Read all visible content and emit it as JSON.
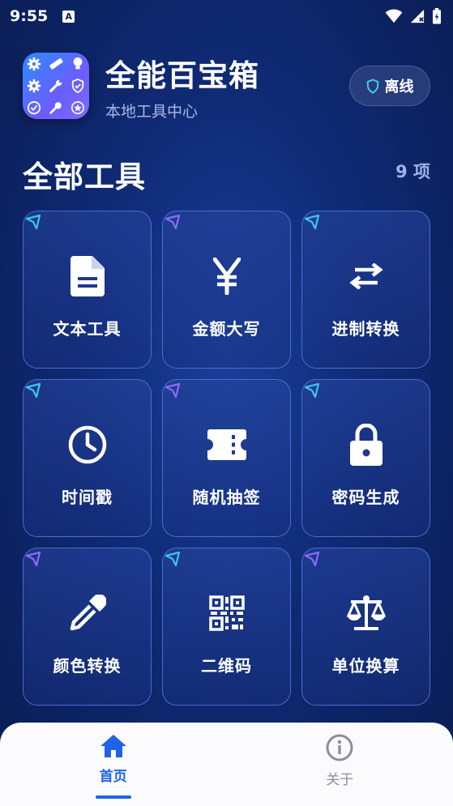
{
  "status_bar": {
    "time": "9:55",
    "notification_badge": "A"
  },
  "header": {
    "app_title": "全能百宝箱",
    "app_subtitle": "本地工具中心",
    "offline_label": "离线"
  },
  "section": {
    "title": "全部工具",
    "count": "9 项"
  },
  "tools": [
    {
      "label": "文本工具",
      "icon": "document-icon",
      "corner_color": "#3ec6e8"
    },
    {
      "label": "金额大写",
      "icon": "yen-icon",
      "corner_color": "#8a6cff"
    },
    {
      "label": "进制转换",
      "icon": "swap-arrows-icon",
      "corner_color": "#3ec6e8"
    },
    {
      "label": "时间戳",
      "icon": "clock-icon",
      "corner_color": "#3ec6e8"
    },
    {
      "label": "随机抽签",
      "icon": "ticket-icon",
      "corner_color": "#8a6cff"
    },
    {
      "label": "密码生成",
      "icon": "lock-icon",
      "corner_color": "#3ec6e8"
    },
    {
      "label": "颜色转换",
      "icon": "eyedropper-icon",
      "corner_color": "#8a6cff"
    },
    {
      "label": "二维码",
      "icon": "qr-code-icon",
      "corner_color": "#3ec6e8"
    },
    {
      "label": "单位换算",
      "icon": "scale-icon",
      "corner_color": "#8a6cff"
    }
  ],
  "bottom_nav": {
    "home_label": "首页",
    "about_label": "关于",
    "active_color": "#1f63e6",
    "inactive_color": "#8a8f9a"
  }
}
